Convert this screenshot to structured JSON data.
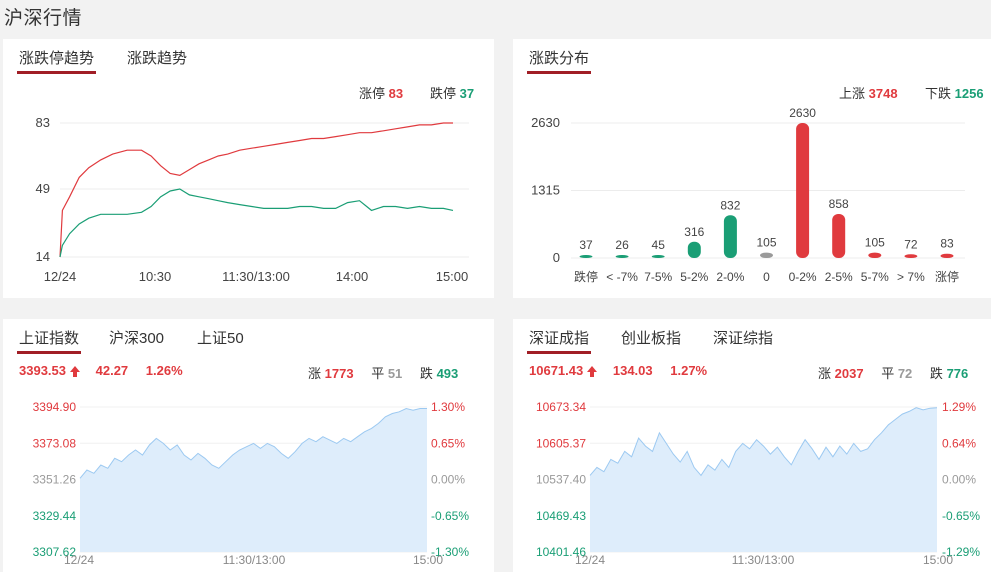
{
  "page_title": "沪深行情",
  "colors": {
    "up": "#e03a3e",
    "down": "#1a9e75",
    "flat": "#9a9a9a",
    "accent": "#a11e26",
    "area_fill": "#deedfb",
    "area_line": "#9cc9f1"
  },
  "trend": {
    "tabs": [
      "涨跌停趋势",
      "涨跌趋势"
    ],
    "active_tab": 0,
    "limit_up_label": "涨停",
    "limit_up_value": "83",
    "limit_down_label": "跌停",
    "limit_down_value": "37",
    "chart_data": {
      "type": "line",
      "y_ticks": [
        "83",
        "49",
        "14"
      ],
      "x_ticks": [
        "12/24",
        "10:30",
        "11:30/13:00",
        "14:00",
        "15:00"
      ],
      "ylim": [
        14,
        83
      ],
      "series": [
        {
          "name": "涨停",
          "color": "#e03a3e",
          "points": [
            [
              0,
              14
            ],
            [
              1,
              38
            ],
            [
              4,
              45
            ],
            [
              8,
              55
            ],
            [
              12,
              60
            ],
            [
              17,
              64
            ],
            [
              22,
              67
            ],
            [
              28,
              69
            ],
            [
              34,
              69
            ],
            [
              38,
              66
            ],
            [
              42,
              61
            ],
            [
              46,
              57
            ],
            [
              50,
              56
            ],
            [
              54,
              59
            ],
            [
              58,
              62
            ],
            [
              62,
              64
            ],
            [
              66,
              66
            ],
            [
              70,
              67
            ],
            [
              75,
              69
            ],
            [
              80,
              70
            ],
            [
              85,
              71
            ],
            [
              90,
              72
            ],
            [
              95,
              73
            ],
            [
              100,
              74
            ],
            [
              105,
              75
            ],
            [
              110,
              75
            ],
            [
              115,
              76
            ],
            [
              120,
              77
            ],
            [
              125,
              78
            ],
            [
              130,
              78
            ],
            [
              135,
              79
            ],
            [
              140,
              80
            ],
            [
              145,
              81
            ],
            [
              150,
              82
            ],
            [
              155,
              82
            ],
            [
              160,
              83
            ],
            [
              164,
              83
            ]
          ]
        },
        {
          "name": "跌停",
          "color": "#1a9e75",
          "points": [
            [
              0,
              14
            ],
            [
              1,
              20
            ],
            [
              4,
              26
            ],
            [
              8,
              31
            ],
            [
              12,
              34
            ],
            [
              17,
              36
            ],
            [
              22,
              36
            ],
            [
              28,
              36
            ],
            [
              34,
              37
            ],
            [
              38,
              40
            ],
            [
              42,
              45
            ],
            [
              46,
              48
            ],
            [
              50,
              49
            ],
            [
              54,
              46
            ],
            [
              58,
              45
            ],
            [
              62,
              44
            ],
            [
              66,
              43
            ],
            [
              70,
              42
            ],
            [
              75,
              41
            ],
            [
              80,
              40
            ],
            [
              85,
              39
            ],
            [
              90,
              39
            ],
            [
              95,
              39
            ],
            [
              100,
              40
            ],
            [
              105,
              40
            ],
            [
              110,
              39
            ],
            [
              115,
              39
            ],
            [
              120,
              42
            ],
            [
              125,
              43
            ],
            [
              128,
              40
            ],
            [
              130,
              38
            ],
            [
              135,
              40
            ],
            [
              140,
              40
            ],
            [
              145,
              39
            ],
            [
              150,
              40
            ],
            [
              155,
              39
            ],
            [
              160,
              39
            ],
            [
              164,
              38
            ]
          ]
        }
      ]
    }
  },
  "dist": {
    "tab": "涨跌分布",
    "up_label": "上涨",
    "up_value": "3748",
    "down_label": "下跌",
    "down_value": "1256",
    "chart_data": {
      "type": "bar",
      "y_ticks": [
        "2630",
        "1315",
        "0"
      ],
      "ylim": [
        0,
        2630
      ],
      "categories": [
        "跌停",
        "< -7%",
        "7-5%",
        "5-2%",
        "2-0%",
        "0",
        "0-2%",
        "2-5%",
        "5-7%",
        "> 7%",
        "涨停"
      ],
      "values": [
        37,
        26,
        45,
        316,
        832,
        105,
        2630,
        858,
        105,
        72,
        83
      ],
      "labels": [
        "37",
        "26",
        "45",
        "316",
        "832",
        "105",
        "2630",
        "858",
        "105",
        "72",
        "83"
      ],
      "colors": [
        "#1a9e75",
        "#1a9e75",
        "#1a9e75",
        "#1a9e75",
        "#1a9e75",
        "#9a9a9a",
        "#e03a3e",
        "#e03a3e",
        "#e03a3e",
        "#e03a3e",
        "#e03a3e"
      ]
    }
  },
  "sh": {
    "tabs": [
      "上证指数",
      "沪深300",
      "上证50"
    ],
    "active_tab": 0,
    "price": "3393.53",
    "change": "42.27",
    "change_pct": "1.26%",
    "up_label": "涨",
    "up_value": "1773",
    "flat_label": "平",
    "flat_value": "51",
    "down_label": "跌",
    "down_value": "493",
    "chart_data": {
      "type": "area",
      "left_ticks": [
        "3394.90",
        "3373.08",
        "3351.26",
        "3329.44",
        "3307.62"
      ],
      "right_ticks": [
        "1.30%",
        "0.65%",
        "0.00%",
        "-0.65%",
        "-1.30%"
      ],
      "x_ticks": [
        "12/24",
        "11:30/13:00",
        "15:00"
      ],
      "ylim": [
        3307.62,
        3394.9
      ],
      "points": [
        [
          0,
          3352
        ],
        [
          2,
          3357
        ],
        [
          4,
          3355
        ],
        [
          6,
          3360
        ],
        [
          8,
          3358
        ],
        [
          10,
          3364
        ],
        [
          12,
          3362
        ],
        [
          14,
          3366
        ],
        [
          16,
          3369
        ],
        [
          18,
          3366
        ],
        [
          20,
          3372
        ],
        [
          22,
          3376
        ],
        [
          24,
          3373
        ],
        [
          26,
          3369
        ],
        [
          28,
          3372
        ],
        [
          30,
          3366
        ],
        [
          32,
          3363
        ],
        [
          34,
          3367
        ],
        [
          36,
          3364
        ],
        [
          38,
          3360
        ],
        [
          40,
          3358
        ],
        [
          42,
          3362
        ],
        [
          44,
          3366
        ],
        [
          46,
          3369
        ],
        [
          48,
          3371
        ],
        [
          50,
          3373
        ],
        [
          52,
          3370
        ],
        [
          54,
          3373
        ],
        [
          56,
          3371
        ],
        [
          58,
          3367
        ],
        [
          60,
          3364
        ],
        [
          62,
          3368
        ],
        [
          64,
          3373
        ],
        [
          66,
          3376
        ],
        [
          68,
          3374
        ],
        [
          70,
          3377
        ],
        [
          72,
          3375
        ],
        [
          74,
          3373
        ],
        [
          76,
          3376
        ],
        [
          78,
          3374
        ],
        [
          80,
          3377
        ],
        [
          82,
          3380
        ],
        [
          84,
          3382
        ],
        [
          86,
          3385
        ],
        [
          88,
          3389
        ],
        [
          90,
          3391
        ],
        [
          92,
          3392
        ],
        [
          94,
          3394
        ],
        [
          96,
          3393
        ],
        [
          98,
          3394
        ],
        [
          100,
          3394
        ]
      ]
    }
  },
  "sz": {
    "tabs": [
      "深证成指",
      "创业板指",
      "深证综指"
    ],
    "active_tab": 0,
    "price": "10671.43",
    "change": "134.03",
    "change_pct": "1.27%",
    "up_label": "涨",
    "up_value": "2037",
    "flat_label": "平",
    "flat_value": "72",
    "down_label": "跌",
    "down_value": "776",
    "chart_data": {
      "type": "area",
      "left_ticks": [
        "10673.34",
        "10605.37",
        "10537.40",
        "10469.43",
        "10401.46"
      ],
      "right_ticks": [
        "1.29%",
        "0.64%",
        "0.00%",
        "-0.65%",
        "-1.29%"
      ],
      "x_ticks": [
        "12/24",
        "11:30/13:00",
        "15:00"
      ],
      "ylim": [
        10401.46,
        10673.34
      ],
      "points": [
        [
          0,
          10545
        ],
        [
          2,
          10560
        ],
        [
          4,
          10552
        ],
        [
          6,
          10575
        ],
        [
          8,
          10568
        ],
        [
          10,
          10590
        ],
        [
          12,
          10580
        ],
        [
          14,
          10615
        ],
        [
          16,
          10600
        ],
        [
          18,
          10590
        ],
        [
          20,
          10625
        ],
        [
          22,
          10605
        ],
        [
          24,
          10585
        ],
        [
          26,
          10570
        ],
        [
          28,
          10590
        ],
        [
          30,
          10560
        ],
        [
          32,
          10545
        ],
        [
          34,
          10565
        ],
        [
          36,
          10555
        ],
        [
          38,
          10575
        ],
        [
          40,
          10560
        ],
        [
          42,
          10590
        ],
        [
          44,
          10605
        ],
        [
          46,
          10595
        ],
        [
          48,
          10612
        ],
        [
          50,
          10600
        ],
        [
          52,
          10585
        ],
        [
          54,
          10598
        ],
        [
          56,
          10580
        ],
        [
          58,
          10565
        ],
        [
          60,
          10590
        ],
        [
          62,
          10612
        ],
        [
          64,
          10595
        ],
        [
          66,
          10575
        ],
        [
          68,
          10598
        ],
        [
          70,
          10580
        ],
        [
          72,
          10600
        ],
        [
          74,
          10585
        ],
        [
          76,
          10605
        ],
        [
          78,
          10590
        ],
        [
          80,
          10595
        ],
        [
          82,
          10612
        ],
        [
          84,
          10625
        ],
        [
          86,
          10640
        ],
        [
          88,
          10650
        ],
        [
          90,
          10660
        ],
        [
          92,
          10665
        ],
        [
          94,
          10672
        ],
        [
          96,
          10668
        ],
        [
          98,
          10671
        ],
        [
          100,
          10672
        ]
      ]
    }
  }
}
